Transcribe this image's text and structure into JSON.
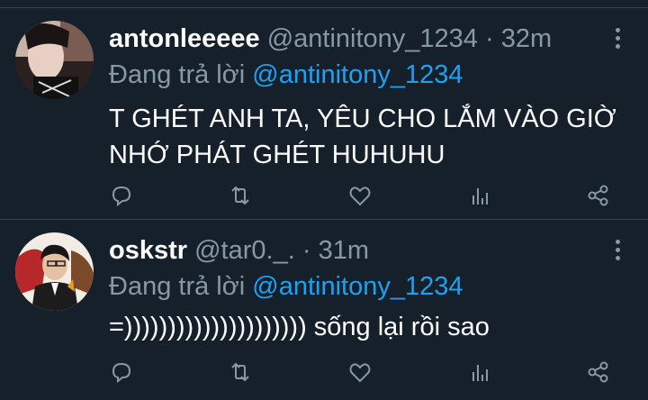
{
  "tweets": [
    {
      "name": "antonleeeee",
      "handle": "@antinitony_1234",
      "separator": "·",
      "time": "32m",
      "reply_prefix": "Đang trả lời",
      "reply_to": "@antinitony_1234",
      "text": "T GHÉT ANH TA, YÊU CHO LẮM VÀO GIỜ NHỚ PHÁT GHÉT HUHUHU",
      "avatar_icon": "profile-photo",
      "actions": [
        "reply-icon",
        "retweet-icon",
        "like-icon",
        "analytics-icon",
        "share-icon"
      ]
    },
    {
      "name": "oskstr",
      "handle": "@tar0._.",
      "separator": "·",
      "time": "31m",
      "reply_prefix": "Đang trả lời",
      "reply_to": "@antinitony_1234",
      "text": "=))))))))))))))))))))) sống lại rồi sao",
      "avatar_icon": "profile-photo",
      "actions": [
        "reply-icon",
        "retweet-icon",
        "like-icon",
        "analytics-icon",
        "share-icon"
      ]
    }
  ],
  "colors": {
    "background": "#15202b",
    "divider": "#38444d",
    "primary_text": "#ffffff",
    "secondary_text": "#8899a6",
    "accent": "#1da1f2"
  }
}
